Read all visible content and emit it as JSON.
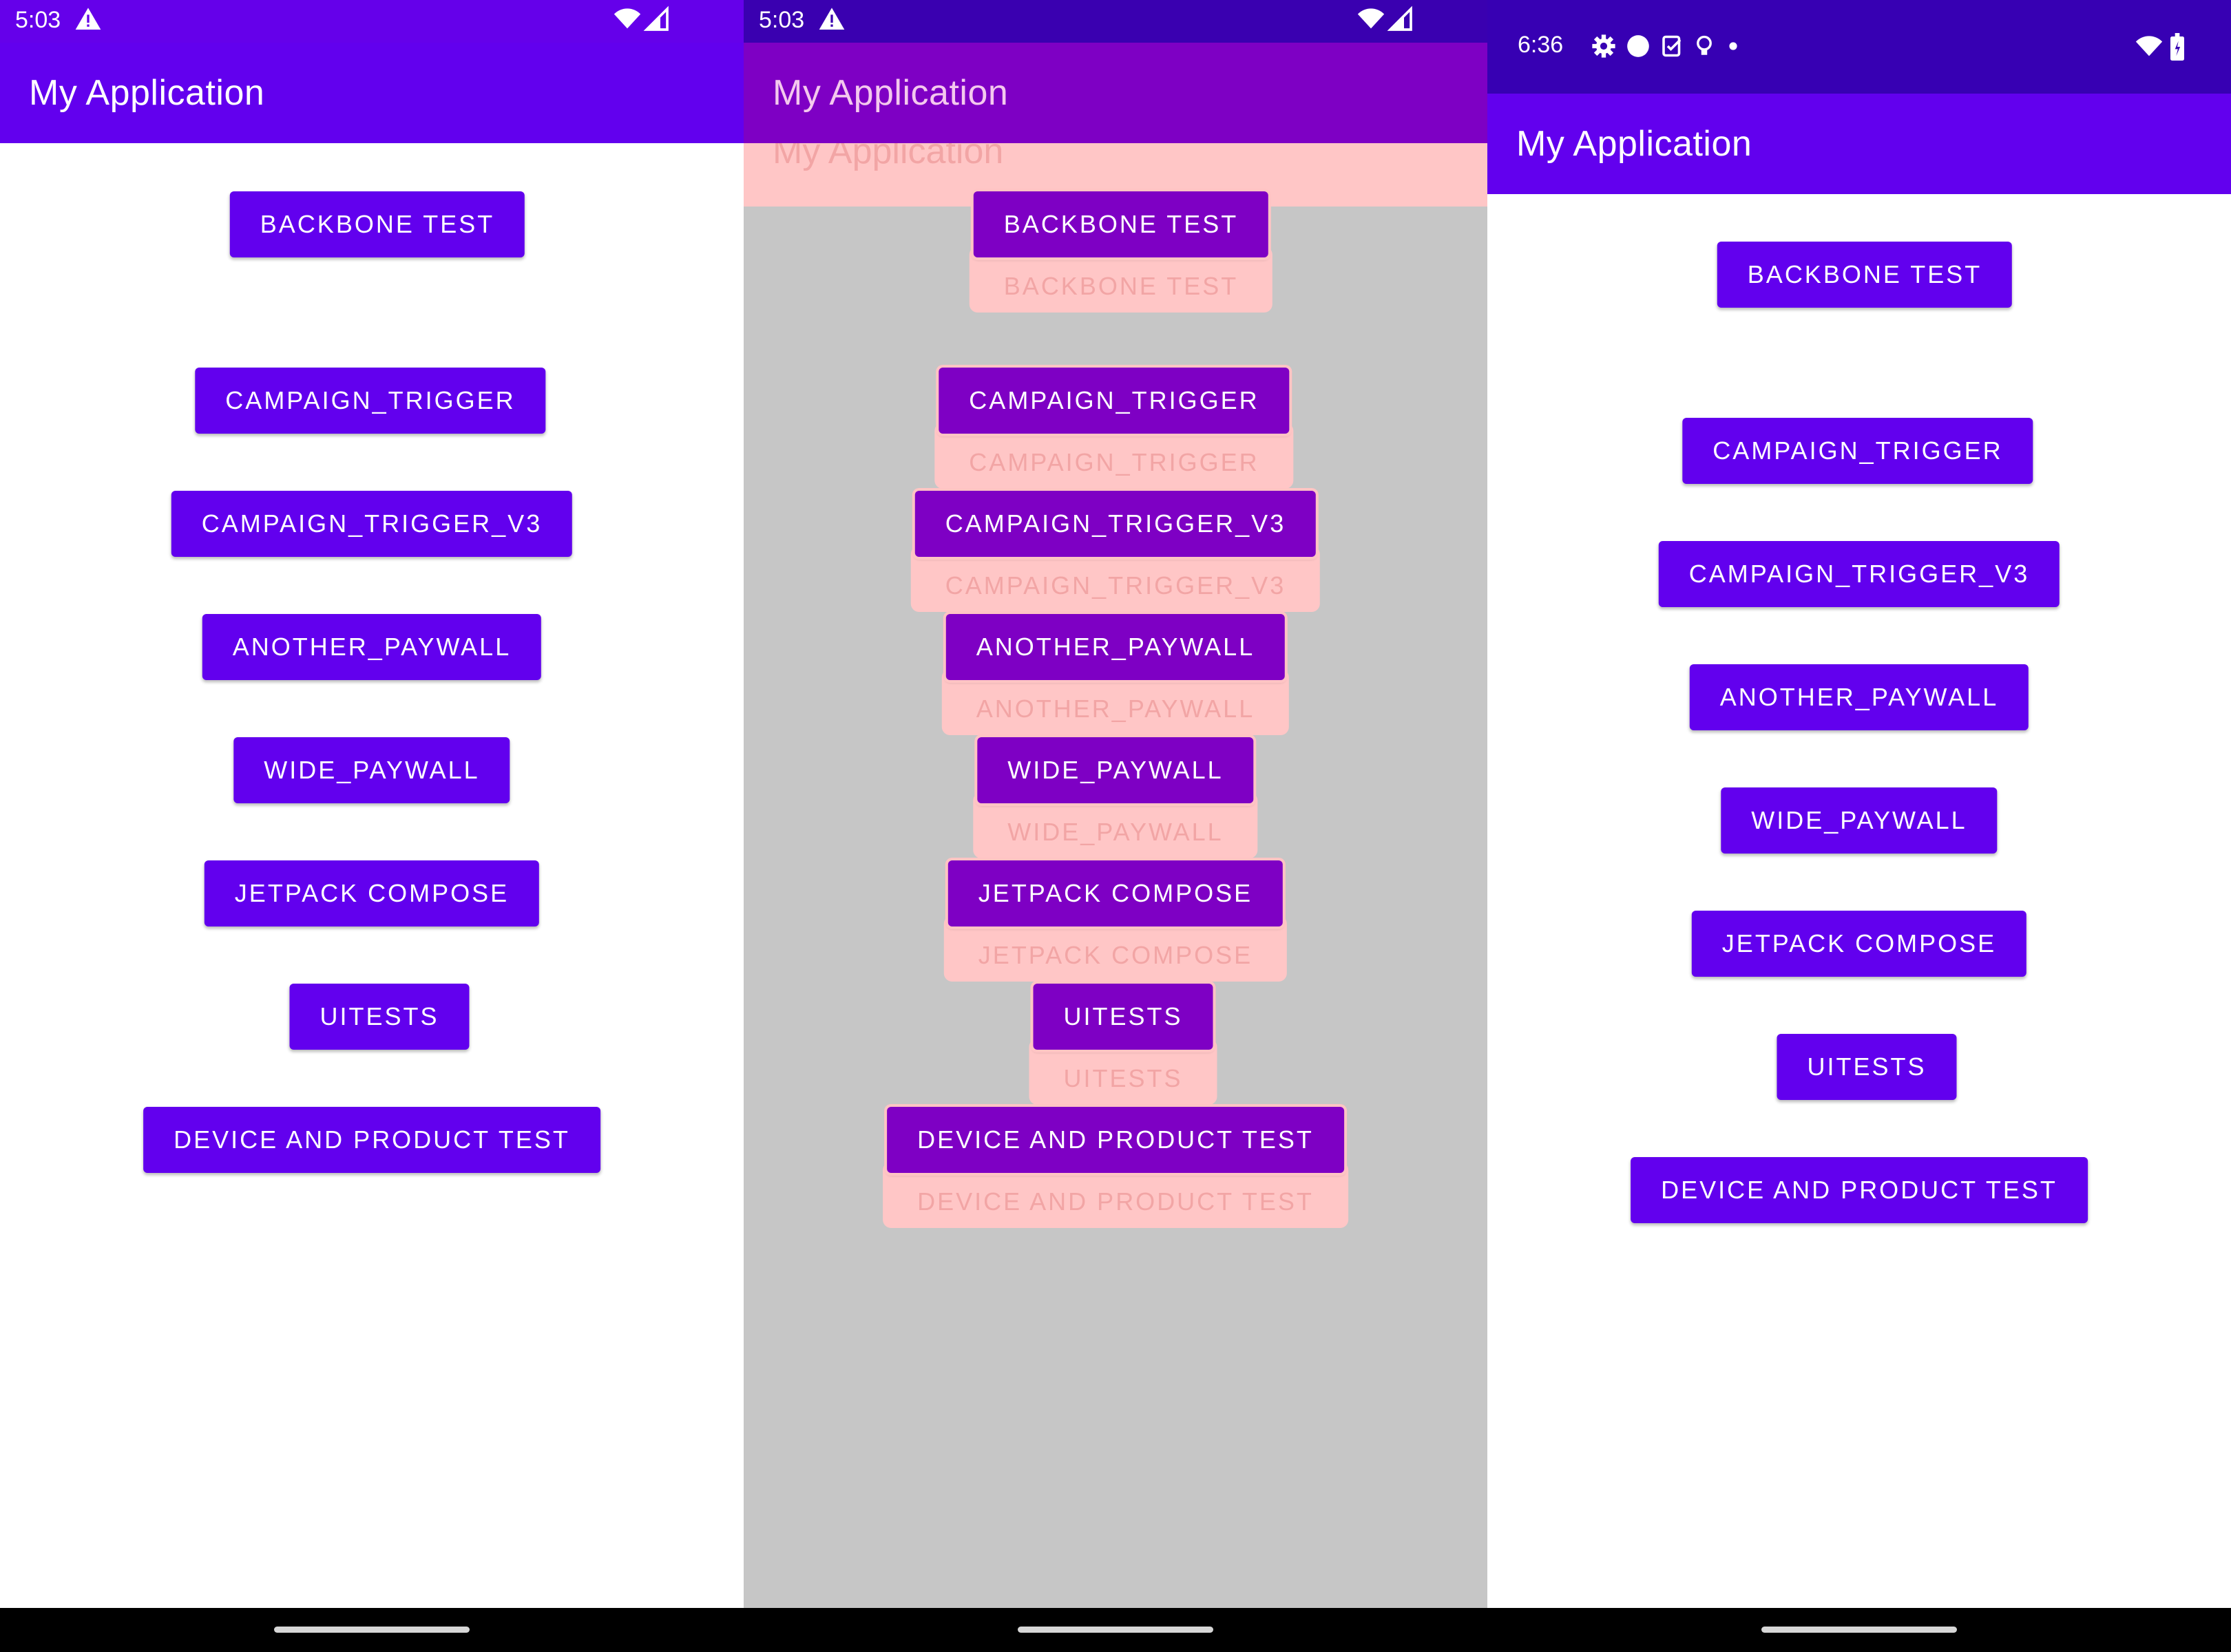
{
  "app_title": "My Application",
  "buttons": {
    "backbone": "BACKBONE TEST",
    "campaign_trigger": "CAMPAIGN_TRIGGER",
    "campaign_trigger_v3": "CAMPAIGN_TRIGGER_V3",
    "another_paywall": "ANOTHER_PAYWALL",
    "wide_paywall": "WIDE_PAYWALL",
    "jetpack_compose": "JETPACK COMPOSE",
    "uitests": "UITESTS",
    "device_product": "DEVICE AND PRODUCT TEST"
  },
  "screens": [
    {
      "time": "5:03",
      "status_icons": [
        "alert-icon",
        "wifi-icon",
        "signal-icon"
      ]
    },
    {
      "time": "5:03",
      "status_icons": [
        "alert-icon",
        "wifi-icon",
        "signal-icon"
      ]
    },
    {
      "time": "6:36",
      "status_icons": [
        "settings-icon",
        "circle-icon",
        "task-icon",
        "bulb-icon",
        "dot-icon",
        "wifi-icon",
        "battery-icon"
      ]
    }
  ],
  "colors": {
    "primary": "#6200ee",
    "status_bar_1": "#6500ea",
    "status_bar_2": "#3a00b0",
    "status_bar_3": "#3700b3",
    "overlay_pink": "#ffc6c6",
    "overlay_bg": "#c6c6c6"
  }
}
